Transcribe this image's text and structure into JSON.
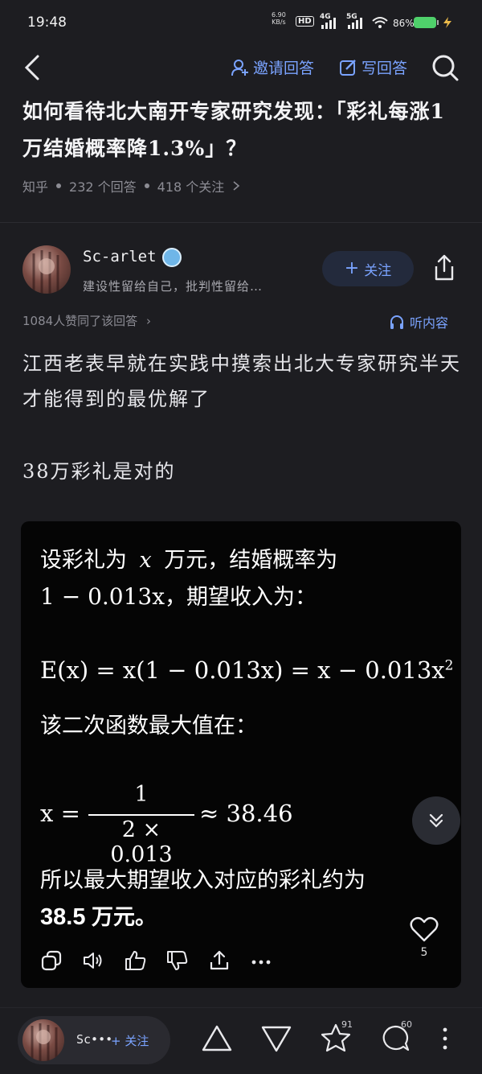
{
  "status_bar": {
    "time": "19:48",
    "net_speed": "6.90",
    "net_unit": "KB/s",
    "hd": "HD",
    "sig1": "4G",
    "sig2": "5G",
    "battery": "86%"
  },
  "header": {
    "invite_label": "邀请回答",
    "write_label": "写回答",
    "question_title": "如何看待北大南开专家研究发现：「彩礼每涨1万结婚概率降1.3%」？",
    "meta_source": "知乎",
    "meta_answers": "232 个回答",
    "meta_follows": "418 个关注"
  },
  "author": {
    "name": "Sc-arlet",
    "bio": "建设性留给自己，批判性留给…",
    "follow_label": "关注",
    "likes_line": "1084人赞同了该回答",
    "listen_label": "听内容"
  },
  "answer": {
    "paragraph1": "江西老表早就在实践中摸索出北大专家研究半天才能得到的最优解了",
    "paragraph2": "38万彩礼是对的"
  },
  "card": {
    "line1_a": "设彩礼为",
    "line1_var": "x",
    "line1_b": "万元，结婚概率为",
    "line2_math": "1 − 0.013x",
    "line2_b": "，期望收入为：",
    "formula1": "E(x) = x(1 − 0.013x) = x − 0.013x",
    "formula1_sup": "2",
    "line3": "该二次函数最大值在：",
    "formula2_lhs": "x =",
    "formula2_num": "1",
    "formula2_den": "2 × 0.013",
    "formula2_rhs": "≈ 38.46",
    "line4": "所以最大期望收入对应的彩礼约为",
    "line5_bold": "38.5",
    "line5_rest": " 万元。",
    "heart_count": "5"
  },
  "bottom_bar": {
    "name": "Sc•••",
    "follow_label": "+ 关注",
    "star_count": "91",
    "comment_count": "60"
  },
  "colors": {
    "background": "#1d1d21",
    "accent": "#7aa3ff",
    "card": "#050505",
    "battery": "#4fd06b"
  }
}
